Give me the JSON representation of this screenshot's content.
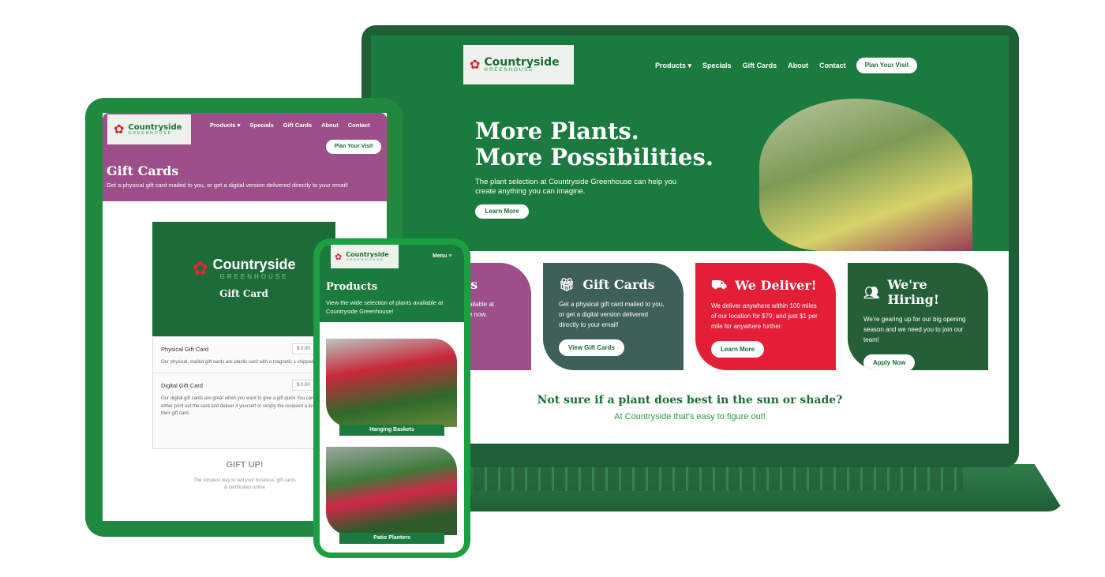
{
  "laptop": {
    "logo": {
      "name": "Countryside",
      "sub": "GREENHOUSE"
    },
    "nav": [
      "Products ▾",
      "Specials",
      "Gift Cards",
      "About",
      "Contact"
    ],
    "cta": "Plan Your Visit",
    "hero": {
      "title1": "More Plants.",
      "title2": "More Possibilities.",
      "text": "The plant selection at Countryside Greenhouse can help you create anything you can imagine.",
      "button": "Learn More"
    },
    "cards": [
      {
        "title": "ls",
        "text": "vailable at\nse now.",
        "color": "#9c4f88"
      },
      {
        "title": "Gift Cards",
        "icon": "gift-icon",
        "text": "Get a physical gift card mailed to you, or get a digital version delivered directly to your email!",
        "button": "View Gift Cards",
        "color": "#3f5f5a"
      },
      {
        "title": "We Deliver!",
        "icon": "truck-icon",
        "text": "We deliver anywhere within 100 miles of our location for $79; and just $1 per mile for anywhere further.",
        "button": "Learn More",
        "color": "#e51e37"
      },
      {
        "title": "We're Hiring!",
        "icon": "people-icon",
        "text": "We're gearing up for our big opening season and we need you to join our team!",
        "button": "Apply Now",
        "color": "#245f38"
      }
    ],
    "bottom": {
      "title": "Not sure if a plant does best in the sun or shade?",
      "sub": "At Countryside that's easy to figure out!"
    }
  },
  "tablet": {
    "nav": [
      "Products ▾",
      "Specials",
      "Gift Cards",
      "About",
      "Contact"
    ],
    "cta": "Plan Your Visit",
    "title": "Gift Cards",
    "subtitle": "Get a physical gift card mailed to you, or get a digital version delivered directly to your email!",
    "card_label": "Gift Card",
    "items": [
      {
        "name": "Physical Gift Card",
        "price": "$ 0.00",
        "desc": "Our physical, mailed gift cards are plastic card with a magnetic s shipped first class USPS. The cards will be processed on the nex business day and placed into the mail system. Shipping and hand fees are $2 per order no matter how many cards are in it."
      },
      {
        "name": "Digital Gift Card",
        "price": "$ 0.00",
        "desc": "Our digital gift cards are great when you want to give a gift quick You can either print out the card and deliver it yourself or simply the recipient a link to their gift card."
      }
    ],
    "giftup": {
      "logo": "GIFT UP!",
      "tagline": "The simplest way to sell your business' gift cards & certificates online"
    }
  },
  "phone": {
    "menu": "Menu ≡",
    "title": "Products",
    "subtitle": "View the wide selection of plants available at Countryside Greenhouse!",
    "products": [
      "Hanging Baskets",
      "Patio Planters"
    ]
  },
  "colors": {
    "brand": "#1b7a3e",
    "dark": "#1b6e35",
    "purple": "#9c4f88",
    "red": "#e51e37"
  }
}
